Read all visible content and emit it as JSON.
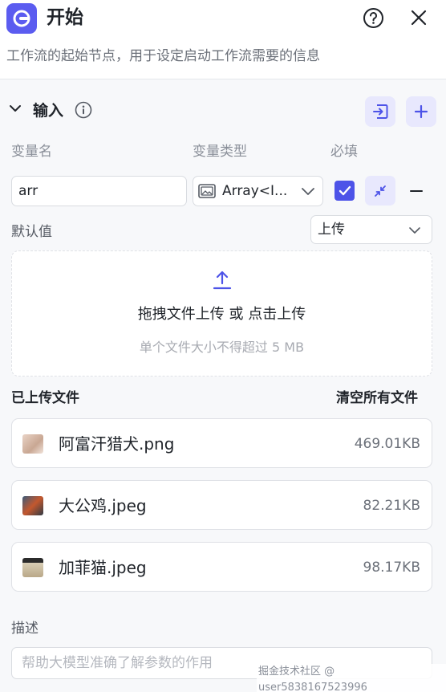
{
  "header": {
    "title": "开始",
    "description": "工作流的起始节点，用于设定启动工作流需要的信息"
  },
  "input_section": {
    "title": "输入",
    "columns": {
      "name": "变量名",
      "type": "变量类型",
      "required": "必填"
    },
    "variable": {
      "name_value": "arr",
      "type_value": "Array<I...",
      "required_checked": true
    },
    "default_value": {
      "label": "默认值",
      "mode": "上传"
    },
    "dropzone": {
      "main_text": "拖拽文件上传 或 点击上传",
      "hint_text": "单个文件大小不得超过 5 MB"
    },
    "uploaded": {
      "title": "已上传文件",
      "clear_all": "清空所有文件",
      "files": [
        {
          "name": "阿富汗猎犬.png",
          "size": "469.01KB"
        },
        {
          "name": "大公鸡.jpeg",
          "size": "82.21KB"
        },
        {
          "name": "加菲猫.jpeg",
          "size": "98.17KB"
        }
      ]
    },
    "describe": {
      "label": "描述",
      "placeholder": "帮助大模型准确了解参数的作用"
    }
  },
  "watermark": "掘金技术社区 @ user5838167523996",
  "colors": {
    "accent": "#4d53e8",
    "accent_light": "#e8e8fd",
    "app_icon": "#5b5cf0",
    "panel_bg": "#f7f8fa"
  },
  "icons": {
    "app": "start-node-icon",
    "help": "help-icon",
    "close": "close-icon",
    "info": "info-icon",
    "import": "import-icon",
    "add": "plus-icon",
    "collapse": "collapse-arrows-icon",
    "remove": "minus-icon",
    "upload": "upload-icon"
  }
}
